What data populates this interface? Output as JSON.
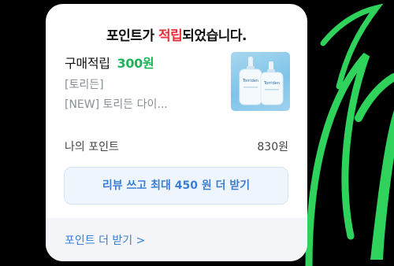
{
  "popup": {
    "title_prefix": "포인트가 ",
    "title_highlight": "적립",
    "title_suffix": "되었습니다.",
    "earn_label": "구매적립",
    "earn_amount": "300원",
    "brand": "[토리든]",
    "product_name": "[NEW] 토리든 다이...",
    "product_image_text": "Torriden",
    "my_point_label": "나의 포인트",
    "my_point_value": "830원",
    "review_button_label": "리뷰 쓰고 최대 450 원 더 받기",
    "more_points_link": "포인트 더 받기 >"
  },
  "colors": {
    "highlight_red": "#e8313a",
    "amount_green": "#20b35a",
    "link_blue": "#3b7fd4",
    "background_swoosh_green": "#2fd35c"
  },
  "icons": [
    "product-thumbnail",
    "background-swoosh"
  ]
}
